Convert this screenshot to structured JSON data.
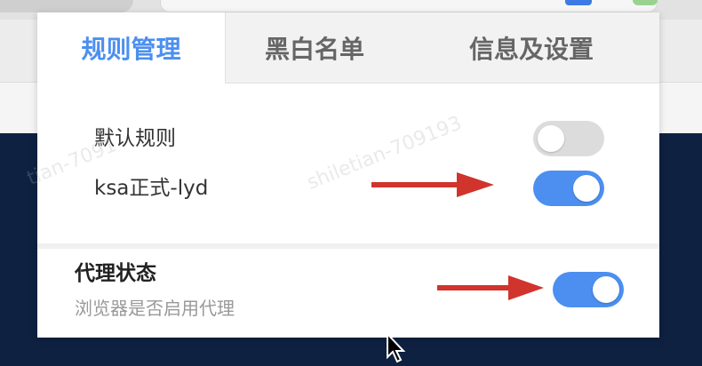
{
  "tabs": [
    {
      "label": "规则管理",
      "active": true
    },
    {
      "label": "黑白名单",
      "active": false
    },
    {
      "label": "信息及设置",
      "active": false
    }
  ],
  "rules": [
    {
      "label": "默认规则",
      "enabled": false
    },
    {
      "label": "ksa正式-lyd",
      "enabled": true
    }
  ],
  "proxy": {
    "title": "代理状态",
    "description": "浏览器是否启用代理",
    "enabled": true
  },
  "watermark": {
    "text_1": "shiletian-709193",
    "text_2": "tian-7091"
  },
  "colors": {
    "accent": "#4c8ff0",
    "toggle_off": "#dcdcdc",
    "arrow": "#d0342c",
    "page_background": "#0e2141"
  },
  "icons": {
    "arrow": "right-arrow-annotation",
    "cursor": "mouse-pointer"
  }
}
